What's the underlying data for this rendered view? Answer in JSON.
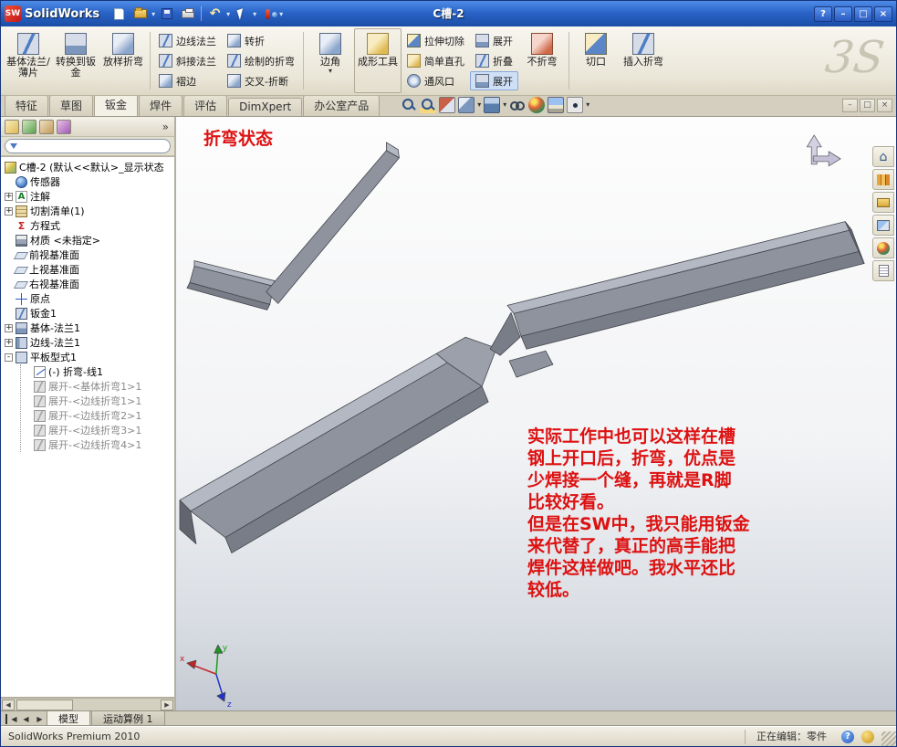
{
  "titlebar": {
    "logo": "SW",
    "app": "SolidWorks",
    "title": "C槽-2"
  },
  "icons": {
    "dropdown": "▾",
    "close": "×",
    "maximize": "□",
    "minimize": "–",
    "help": "?",
    "chevrons": "»",
    "plus": "+",
    "minus": "-",
    "prev": "◀",
    "next": "▶",
    "undo": "↶",
    "home": "⌂",
    "sigma": "Σ",
    "annotation_a": "A"
  },
  "ribbon": {
    "base_flange": "基体法兰/薄片",
    "convert_to_sheet_metal": "转换到钣金",
    "lofted_bend": "放样折弯",
    "edge_flange": "边线法兰",
    "miter_flange": "斜接法兰",
    "hem": "褶边",
    "jog": "转折",
    "sketched_bend": "绘制的折弯",
    "cross_break": "交叉-折断",
    "corner": "边角",
    "forming_tool": "成形工具",
    "extruded_cut": "拉伸切除",
    "simple_hole": "简单直孔",
    "vent": "通风口",
    "unfold": "展开",
    "fold": "折叠",
    "flatten": "展开",
    "no_bends": "不折弯",
    "rip": "切口",
    "insert_bends": "插入折弯",
    "watermark": "3S"
  },
  "command_tabs": [
    "特征",
    "草图",
    "钣金",
    "焊件",
    "评估",
    "DimXpert",
    "办公室产品"
  ],
  "tree": {
    "root": "C槽-2 (默认<<默认>_显示状态",
    "items": [
      "传感器",
      "注解",
      "切割清单(1)",
      "方程式",
      "材质 <未指定>",
      "前视基准面",
      "上视基准面",
      "右视基准面",
      "原点",
      "钣金1",
      "基体-法兰1",
      "边线-法兰1",
      "平板型式1",
      "(-) 折弯-线1",
      "展开-<基体折弯1>1",
      "展开-<边线折弯1>1",
      "展开-<边线折弯2>1",
      "展开-<边线折弯3>1",
      "展开-<边线折弯4>1"
    ]
  },
  "viewport": {
    "annotation_title": "折弯状态",
    "annotation_lines": [
      "实际工作中也可以这样在槽",
      "钢上开口后，折弯，优点是",
      "少焊接一个缝，再就是R脚",
      "比较好看。",
      "但是在SW中，我只能用钣金",
      "来代替了，真正的高手能把",
      "焊件这样做吧。我水平还比",
      "较低。"
    ],
    "triad": {
      "x": "x",
      "y": "y",
      "z": "z"
    }
  },
  "bottom_tabs": [
    "模型",
    "运动算例 1"
  ],
  "statusbar": {
    "product": "SolidWorks Premium 2010",
    "editing": "正在编辑：零件"
  },
  "colors": {
    "annotation_red": "#dd1111",
    "titlebar_blue": "#2a64c8",
    "model_gray": "#8e939e",
    "active_tool_bg": "#cfe0f6"
  }
}
